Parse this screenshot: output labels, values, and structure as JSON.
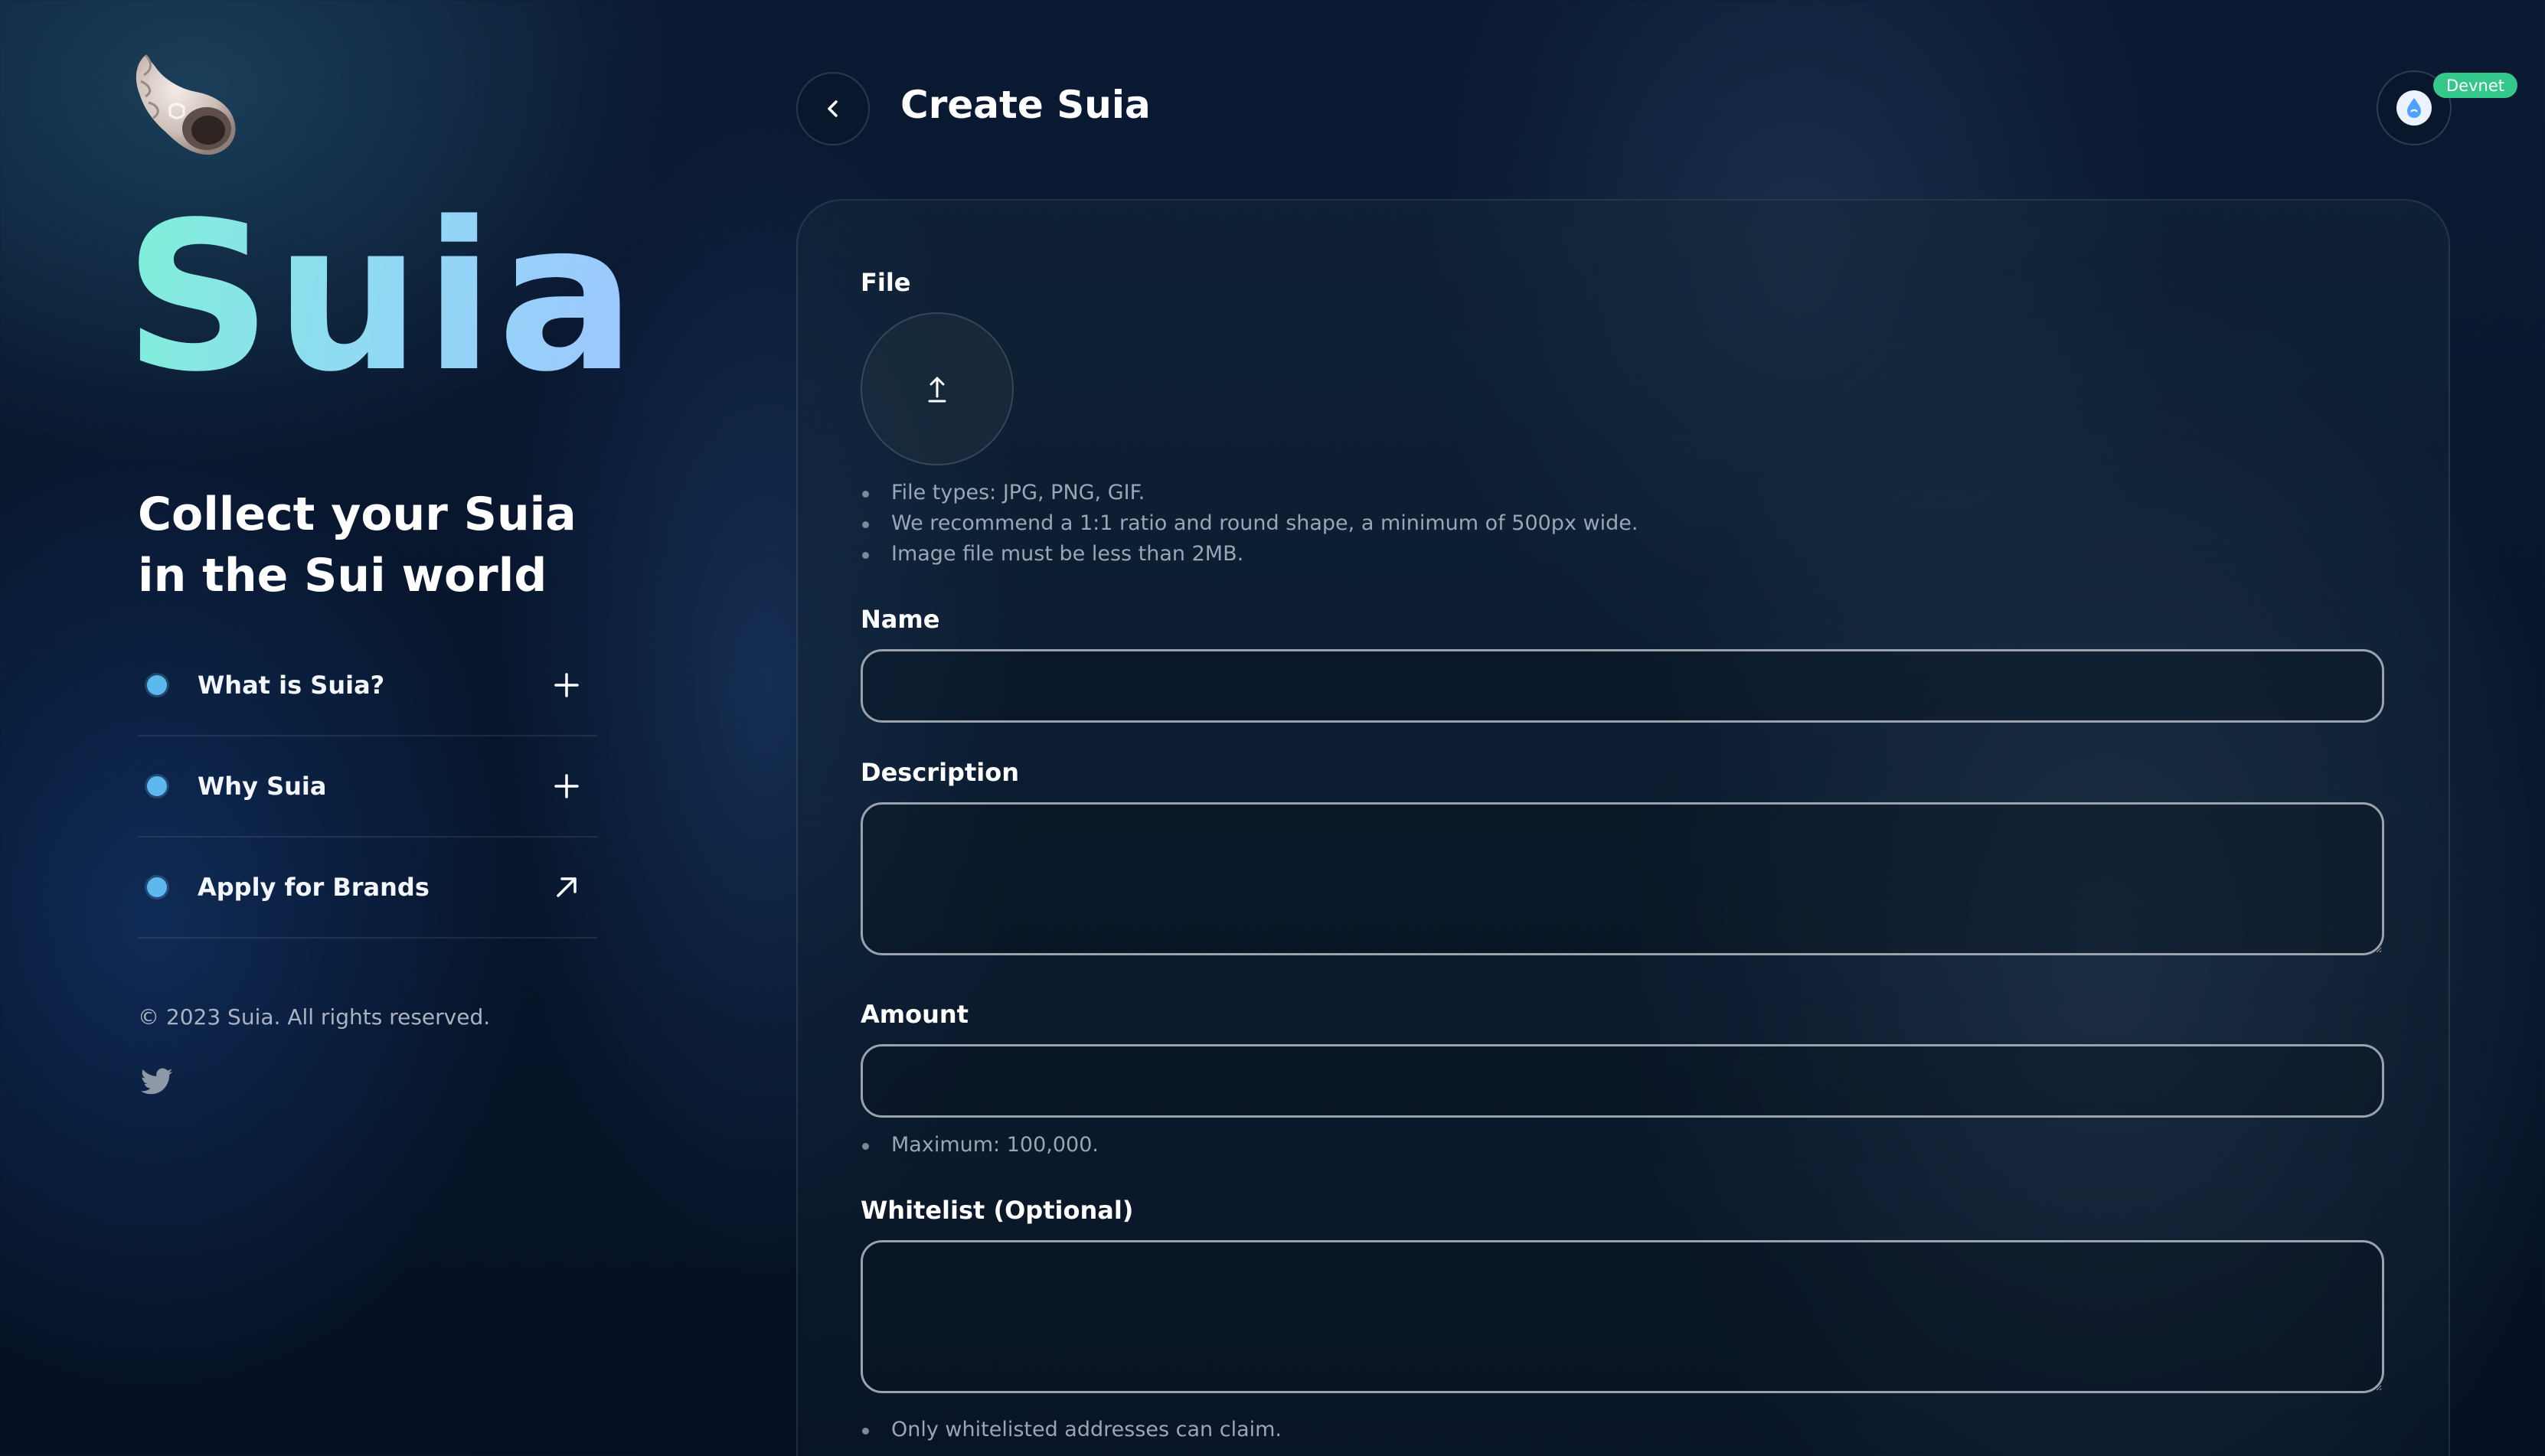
{
  "brand": {
    "name": "Suia",
    "tagline": "Collect your Suia in the Sui world"
  },
  "faq": [
    {
      "label": "What is Suia?",
      "action": "plus"
    },
    {
      "label": "Why Suia",
      "action": "plus"
    },
    {
      "label": "Apply for Brands",
      "action": "external-arrow"
    }
  ],
  "footer": {
    "copyright": "© 2023 Suia. All rights reserved."
  },
  "header": {
    "title": "Create Suia"
  },
  "wallet": {
    "network_badge": "Devnet"
  },
  "form": {
    "file": {
      "label": "File",
      "hints": [
        "File types: JPG, PNG, GIF.",
        "We recommend a 1:1 ratio and round shape, a minimum of 500px wide.",
        "Image file must be less than 2MB."
      ]
    },
    "name": {
      "label": "Name",
      "value": ""
    },
    "description": {
      "label": "Description",
      "value": ""
    },
    "amount": {
      "label": "Amount",
      "value": "",
      "hint": "Maximum: 100,000."
    },
    "whitelist": {
      "label": "Whitelist (Optional)",
      "value": "",
      "hint": "Only whitelisted addresses can claim."
    }
  },
  "colors": {
    "accent_dot": "#5db8ee",
    "network_badge": "#34c98a",
    "brand_gradient_start": "#7ff0d8",
    "brand_gradient_end": "#9ec6ff"
  },
  "icons": [
    "shell-logo-icon",
    "chevron-left-icon",
    "sui-drop-icon",
    "upload-arrow-icon",
    "plus-icon",
    "external-arrow-icon",
    "twitter-icon"
  ]
}
